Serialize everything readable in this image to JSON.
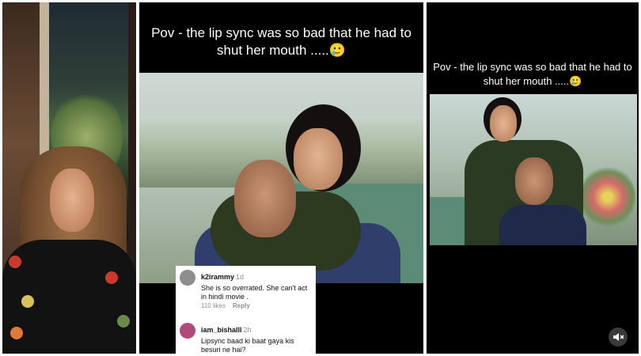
{
  "center_video": {
    "caption": "Pov - the lip sync was so bad that he had to shut her mouth .....🥲"
  },
  "comments": [
    {
      "username": "k2irammy",
      "time": "1d",
      "text": "She is so overrated. She can't act in hindi movie .",
      "likes": "110 likes",
      "reply_label": "Reply",
      "avatar_color": "#8d8d8d"
    },
    {
      "username": "iam_bishalll",
      "time": "2h",
      "text": "Lipsync baad ki baat gaya kis besuri ne hai?",
      "avatar_color": "#b04a7a"
    }
  ],
  "right_video": {
    "caption": "Pov - the lip sync was so bad that he had to shut her mouth .....🥲",
    "mute_icon": "speaker-muted-icon"
  },
  "colors": {
    "background": "#ffffff",
    "video_background": "#000000"
  }
}
